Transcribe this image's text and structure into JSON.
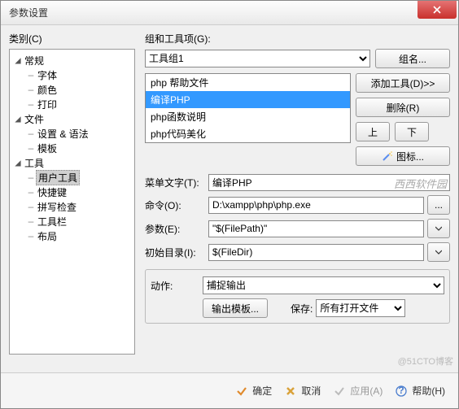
{
  "title": "参数设置",
  "left_label": "类别(C)",
  "tree": [
    {
      "label": "常规",
      "exp": true
    },
    {
      "label": "字体",
      "child": true
    },
    {
      "label": "颜色",
      "child": true
    },
    {
      "label": "打印",
      "child": true
    },
    {
      "label": "文件",
      "exp": true
    },
    {
      "label": "设置 & 语法",
      "child": true
    },
    {
      "label": "模板",
      "child": true
    },
    {
      "label": "工具",
      "exp": true
    },
    {
      "label": "用户工具",
      "child": true,
      "selected": true
    },
    {
      "label": "快捷键",
      "child": true
    },
    {
      "label": "拼写检查",
      "child": true
    },
    {
      "label": "工具栏",
      "child": true
    },
    {
      "label": "布局",
      "child": true
    }
  ],
  "right_label": "组和工具项(G):",
  "group_combo": "工具组1",
  "btn_group_name": "组名...",
  "btn_add_tool": "添加工具(D)>>",
  "btn_delete": "删除(R)",
  "btn_up": "上",
  "btn_down": "下",
  "btn_icon": "图标...",
  "tool_items": [
    {
      "label": "php 帮助文件"
    },
    {
      "label": "编译PHP",
      "sel": true
    },
    {
      "label": "php函数说明"
    },
    {
      "label": "php代码美化"
    }
  ],
  "fields": {
    "menu_text_label": "菜单文字(T):",
    "menu_text_value": "编译PHP",
    "cmd_label": "命令(O):",
    "cmd_value": "D:\\xampp\\php\\php.exe",
    "arg_label": "参数(E):",
    "arg_value": "\"$(FilePath)\"",
    "init_label": "初始目录(I):",
    "init_value": "$(FileDir)"
  },
  "action_label": "动作:",
  "action_combo": "捕捉输出",
  "btn_output_tpl": "输出模板...",
  "save_label": "保存:",
  "save_combo": "所有打开文件",
  "watermark": "西西软件园",
  "corner_wm": "@51CTO博客",
  "bottom": {
    "ok": "确定",
    "cancel": "取消",
    "apply": "应用(A)",
    "help": "帮助(H)"
  }
}
